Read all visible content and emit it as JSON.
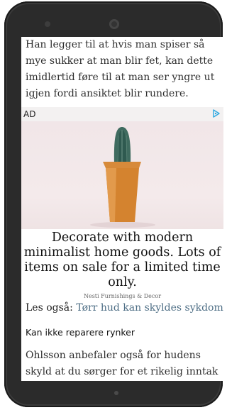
{
  "article": {
    "intro_paragraph": "Han legger til at hvis man spiser så mye sukker at man blir fet, kan dette imidlertid føre til at man ser yngre ut igjen fordi ansiktet blir rundere.",
    "read_also_label": "Les også:",
    "read_also_link": "Tørr hud kan skyldes sykdom",
    "subheading": "Kan ikke reparere rynker",
    "body_paragraph": "Ohlsson anbefaler også for hudens skyld at du sørger for et rikelig inntak av vitaminer"
  },
  "ad": {
    "label": "AD",
    "choices_icon": "adchoices-triangle-icon",
    "image_subject": "cactus-in-pot",
    "headline": "Decorate with modern minimalist home goods. Lots of items on sale for a limited time only.",
    "sponsor": "Nesti Furnishings & Decor"
  },
  "colors": {
    "link": "#4f6f86",
    "ad_choices": "#2aa7e0",
    "phone_frame": "#2b2b2b"
  }
}
